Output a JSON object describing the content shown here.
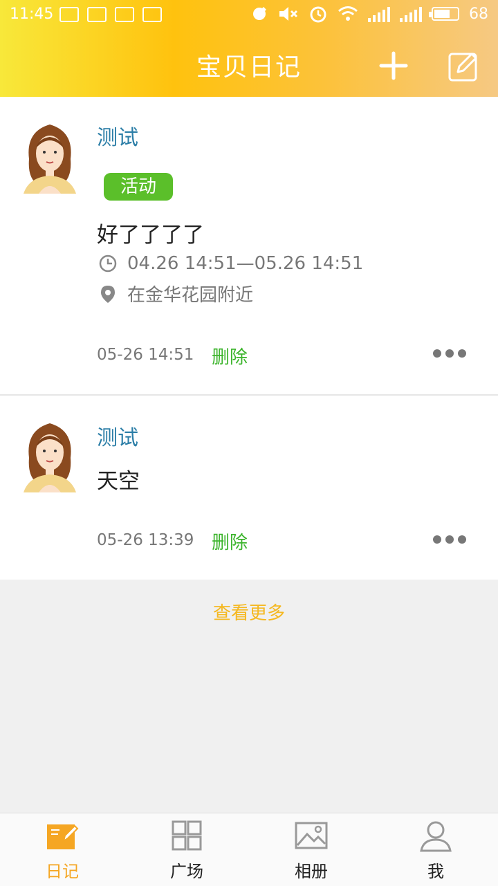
{
  "status_bar": {
    "time": "11:45",
    "battery": "68",
    "network": "4G"
  },
  "header": {
    "title": "宝贝日记"
  },
  "posts": [
    {
      "username": "测试",
      "tag": "活动",
      "content": "好了了了了",
      "time_range": "04.26 14:51—05.26 14:51",
      "location": "在金华花园附近",
      "timestamp": "05-26 14:51",
      "delete_label": "删除"
    },
    {
      "username": "测试",
      "content": "天空",
      "timestamp": "05-26 13:39",
      "delete_label": "删除"
    }
  ],
  "view_more": "查看更多",
  "tabs": [
    {
      "label": "日记",
      "icon": "diary-icon",
      "active": true
    },
    {
      "label": "广场",
      "icon": "grid-icon",
      "active": false
    },
    {
      "label": "相册",
      "icon": "album-icon",
      "active": false
    },
    {
      "label": "我",
      "icon": "person-icon",
      "active": false
    }
  ],
  "colors": {
    "header_gradient_start": "#f8e83a",
    "header_gradient_end": "#f6c983",
    "accent": "#f5a623",
    "tag_green": "#5bbf2a",
    "delete_green": "#3cb42c",
    "username_blue": "#2c7ea7"
  }
}
